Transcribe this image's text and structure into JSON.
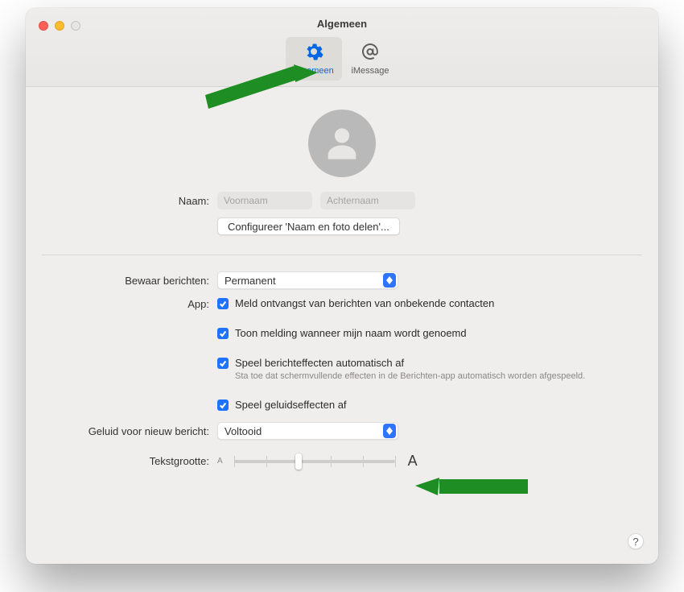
{
  "window": {
    "title": "Algemeen"
  },
  "tabs": {
    "general": "Algemeen",
    "imessage": "iMessage"
  },
  "profile": {
    "namelabel": "Naam:",
    "first_ph": "Voornaam",
    "last_ph": "Achternaam",
    "config_button": "Configureer 'Naam en foto delen'..."
  },
  "keep": {
    "label": "Bewaar berichten:",
    "value": "Permanent"
  },
  "app": {
    "label": "App:",
    "opt1": "Meld ontvangst van berichten van onbekende contacten",
    "opt2": "Toon melding wanneer mijn naam wordt genoemd",
    "opt3": "Speel berichteffecten automatisch af",
    "opt3_sub": "Sta toe dat schermvullende effecten in de Berichten-app automatisch worden afgespeeld.",
    "opt4": "Speel geluidseffecten af"
  },
  "sound": {
    "label": "Geluid voor nieuw bericht:",
    "value": "Voltooid"
  },
  "textsize": {
    "label": "Tekstgrootte:",
    "small": "A",
    "large": "A"
  },
  "help": "?"
}
